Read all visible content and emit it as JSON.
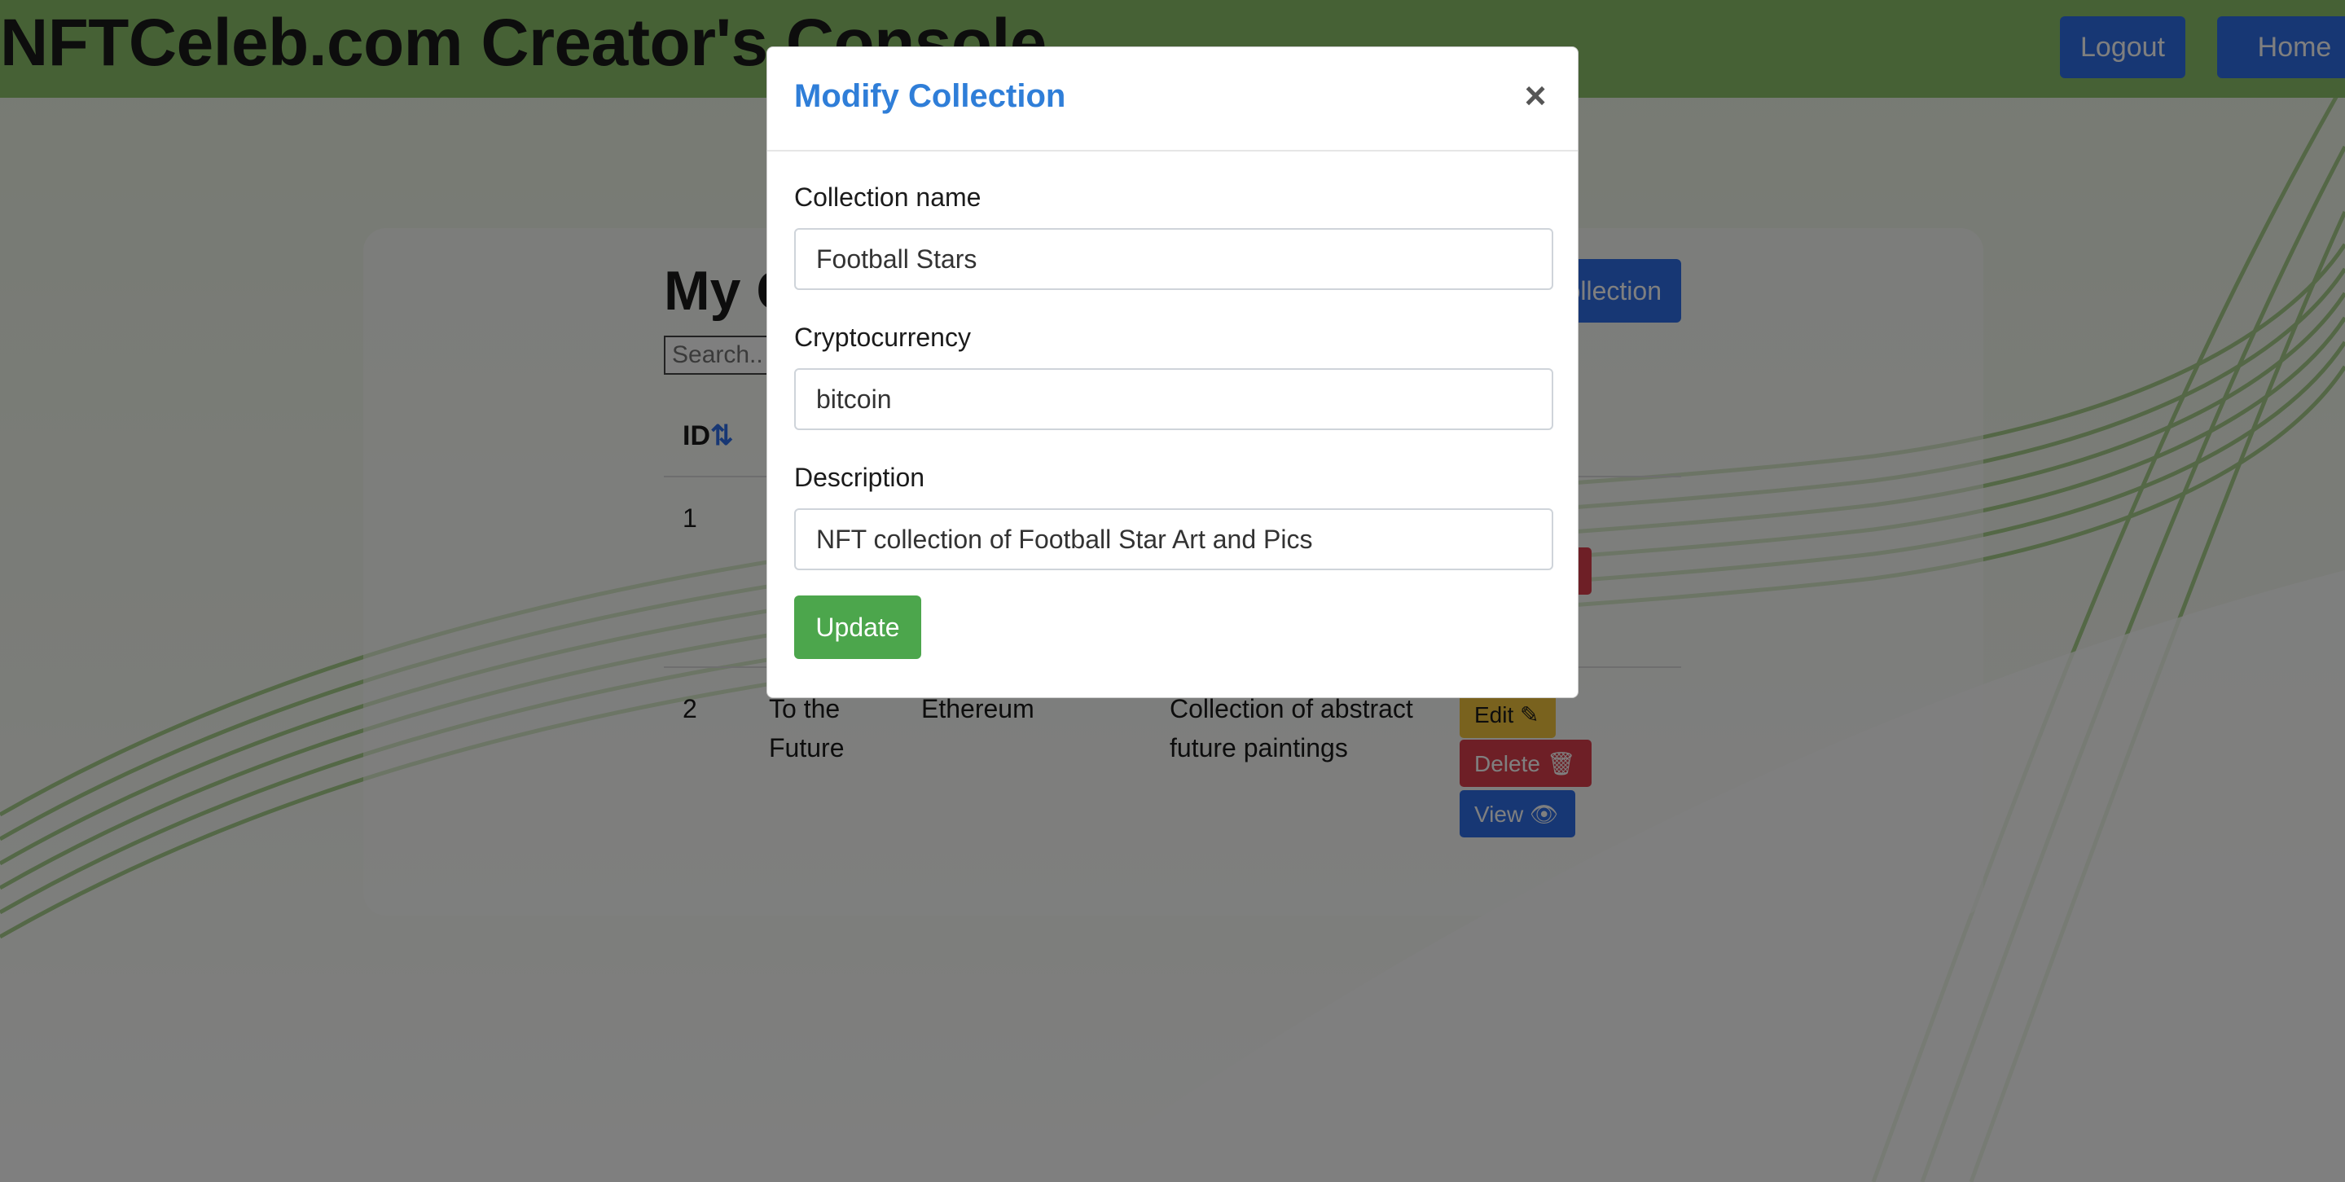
{
  "app": {
    "title": "NFTCeleb.com Creator's Console"
  },
  "nav": {
    "logout": "Logout",
    "home": "Home"
  },
  "page": {
    "title": "My Collections",
    "add_button": "Add New Collection",
    "search_placeholder": "Search..",
    "id_header": "ID",
    "sort_icon": "⇅"
  },
  "table": {
    "rows": [
      {
        "id": "1"
      },
      {
        "id": "2",
        "name": "To the Future",
        "crypto": "Ethereum",
        "description": "Collection of abstract future paintings"
      }
    ],
    "actions": {
      "edit": "Edit ✎",
      "delete": "Delete 🗑",
      "view": "View 👁"
    }
  },
  "modal": {
    "title": "Modify Collection",
    "close": "×",
    "fields": {
      "name_label": "Collection name",
      "name_value": "Football Stars",
      "crypto_label": "Cryptocurrency",
      "crypto_value": "bitcoin",
      "description_label": "Description",
      "description_value": "NFT collection of Football Star Art and Pics"
    },
    "update": "Update"
  },
  "colors": {
    "navbar": "#8dc26b",
    "primary": "#2f6fe8",
    "success": "#4ca64c",
    "danger": "#dc3f4c",
    "warning": "#f2c43d",
    "modal_title": "#2f7ed8"
  }
}
